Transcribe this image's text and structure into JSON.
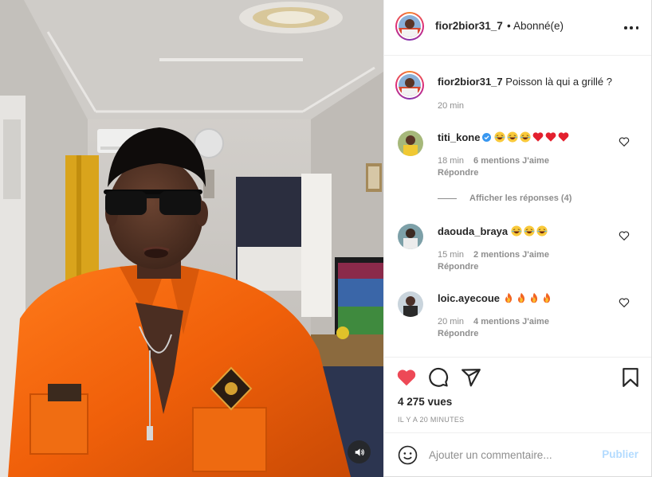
{
  "header": {
    "username": "fior2bior31_7",
    "separator": "•",
    "follow_status": "Abonné(e)",
    "more_icon": "more-horizontal-icon"
  },
  "caption": {
    "username": "fior2bior31_7",
    "text": "Poisson là qui a grillé ?",
    "time": "20 min"
  },
  "comments": [
    {
      "username": "titi_kone",
      "verified": true,
      "emojis": [
        "laugh",
        "laugh",
        "laugh",
        "heart",
        "heart",
        "heart"
      ],
      "time": "18 min",
      "likes": "6 mentions J'aime",
      "reply": "Répondre"
    },
    {
      "username": "daouda_braya",
      "verified": false,
      "emojis": [
        "laugh",
        "laugh",
        "laugh"
      ],
      "time": "15 min",
      "likes": "2 mentions J'aime",
      "reply": "Répondre"
    },
    {
      "username": "loic.ayecoue",
      "verified": false,
      "emojis": [
        "fire",
        "fire",
        "fire",
        "fire"
      ],
      "time": "20 min",
      "likes": "4 mentions J'aime",
      "reply": "Répondre"
    }
  ],
  "view_replies": "Afficher les réponses (4)",
  "actions": {
    "liked": true,
    "icons": [
      "heart-filled-icon",
      "comment-icon",
      "share-icon",
      "bookmark-icon"
    ],
    "like_color": "#ed4956"
  },
  "views": "4 275 vues",
  "posted": "IL Y A 20 MINUTES",
  "add_comment": {
    "placeholder": "Ajouter un commentaire...",
    "publish": "Publier",
    "publish_color": "#b3dbff"
  },
  "video": {
    "sound_icon": "volume-icon"
  }
}
